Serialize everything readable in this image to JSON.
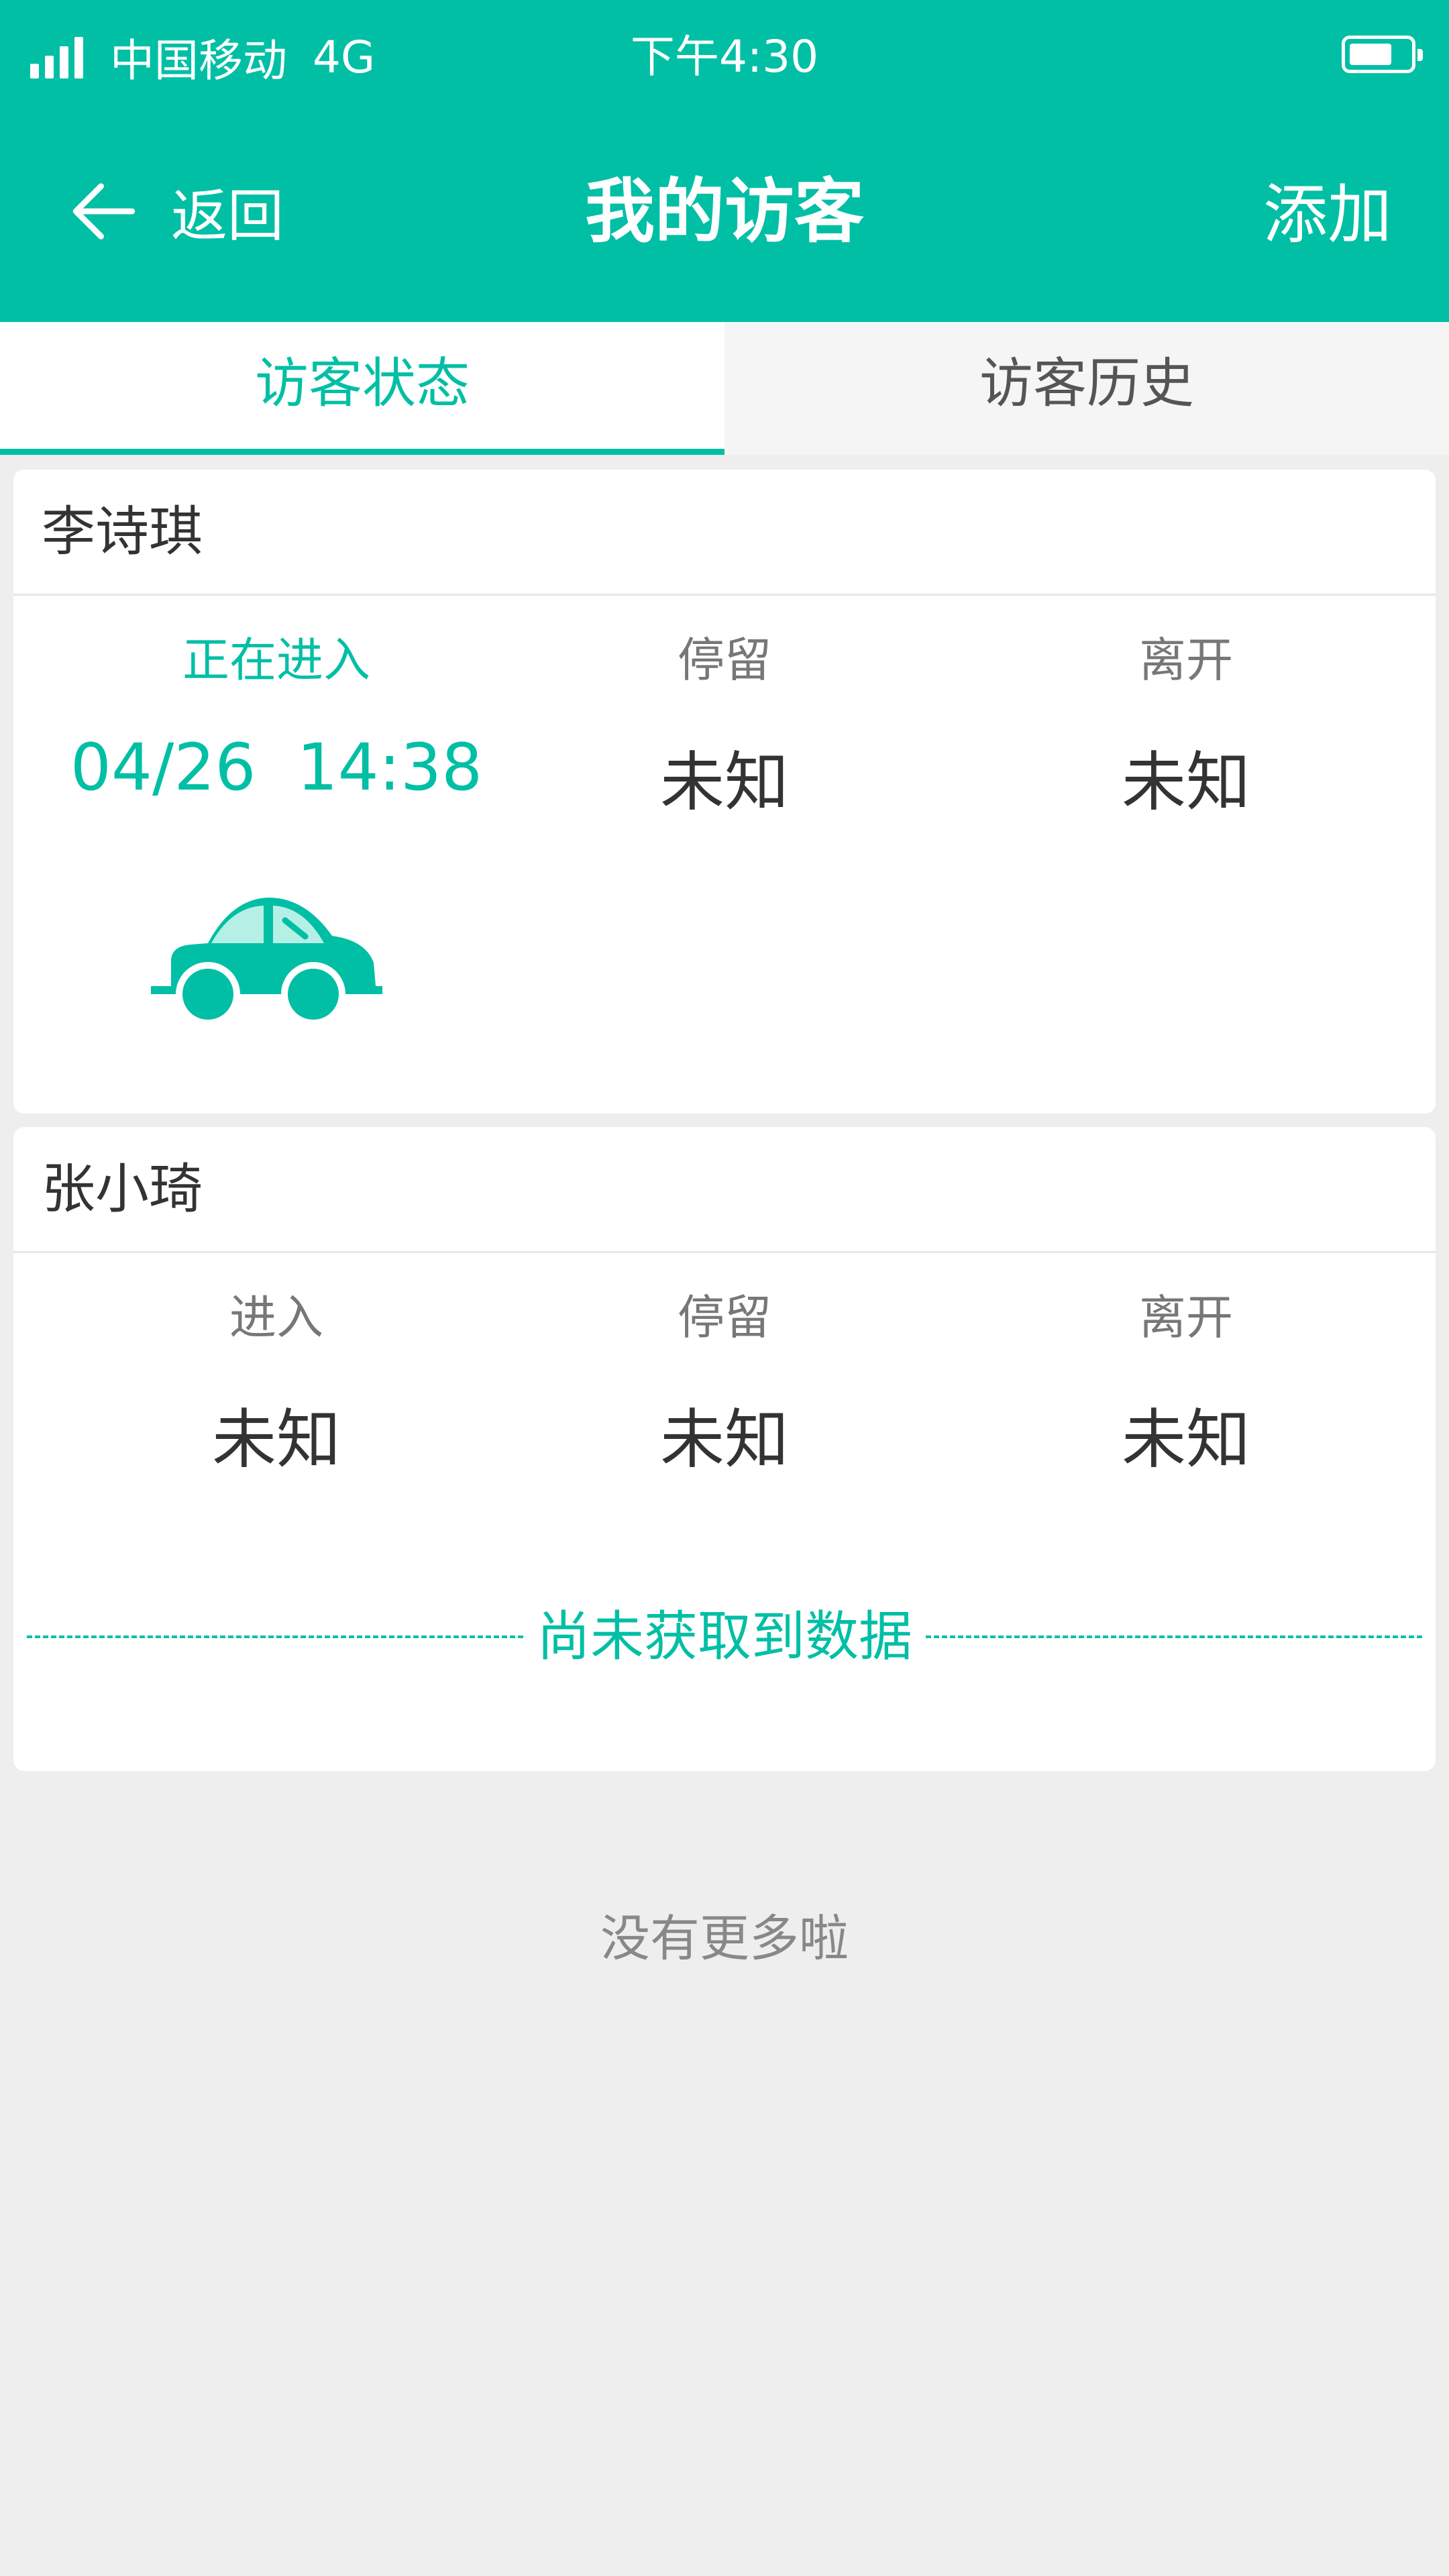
{
  "status_bar": {
    "carrier": "中国移动",
    "network": "4G",
    "time": "下午4:30"
  },
  "nav": {
    "back_label": "返回",
    "title": "我的访客",
    "action_label": "添加"
  },
  "tabs": [
    {
      "label": "访客状态",
      "active": true
    },
    {
      "label": "访客历史",
      "active": false
    }
  ],
  "visitors": [
    {
      "name": "李诗琪",
      "columns": [
        {
          "label": "正在进入",
          "value": "04/26  14:38"
        },
        {
          "label": "停留",
          "value": "未知"
        },
        {
          "label": "离开",
          "value": "未知"
        }
      ]
    },
    {
      "name": "张小琦",
      "columns": [
        {
          "label": "进入",
          "value": "未知"
        },
        {
          "label": "停留",
          "value": "未知"
        },
        {
          "label": "离开",
          "value": "未知"
        }
      ],
      "empty_text": "尚未获取到数据"
    }
  ],
  "footer": {
    "no_more": "没有更多啦"
  },
  "colors": {
    "accent": "#00bfa5",
    "background": "#eeeeee"
  },
  "icons": {
    "back": "arrow-left-icon",
    "vehicle": "car-icon",
    "signal": "signal-icon",
    "battery": "battery-icon"
  }
}
